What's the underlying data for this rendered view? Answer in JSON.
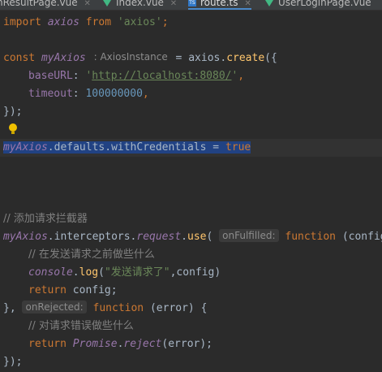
{
  "tabs": [
    {
      "label": "hResultPage.vue",
      "icon": "vue-icon",
      "active": false
    },
    {
      "label": "Index.vue",
      "icon": "vue-icon",
      "active": false
    },
    {
      "label": "route.ts",
      "icon": "ts-icon",
      "active": true
    },
    {
      "label": "UserLoginPage.vue",
      "icon": "vue-icon",
      "active": false
    }
  ],
  "editor": {
    "line1": {
      "kw_import": "import",
      "name": "axios",
      "kw_from": "from",
      "module": "'axios'",
      "semi": ";"
    },
    "line2": {
      "kw_const": "const",
      "name": "myAxios",
      "type_hint": ": AxiosInstance",
      "assign": " = axios.",
      "call": "create",
      "open": "({"
    },
    "line3": {
      "key": "baseURL",
      "colon": ": ",
      "quote_open": "'",
      "url": "http://localhost:8080/",
      "quote_close": "'",
      "comma": ","
    },
    "line4": {
      "key": "timeout",
      "colon": ": ",
      "value": "100000000",
      "comma": ","
    },
    "line5": {
      "close": "});"
    },
    "line6": {
      "obj": "myAxios",
      "rest": ".defaults.withCredentials = ",
      "value": "true"
    },
    "line7": {
      "comment": "// 添加请求拦截器"
    },
    "line8": {
      "obj": "myAxios",
      "p1": ".interceptors.",
      "p2": "request",
      "p3": ".",
      "call": "use",
      "open": "(",
      "hint": "onFulfilled:",
      "kw_function": "function",
      "args": " (config"
    },
    "line9": {
      "comment": "// 在发送请求之前做些什么"
    },
    "line10": {
      "obj": "console",
      "dot": ".",
      "call": "log",
      "open": "(",
      "str": "\"发送请求了\"",
      "rest": ",config)"
    },
    "line11": {
      "kw_return": "return",
      "rest": " config;"
    },
    "line12": {
      "close": "}, ",
      "hint": "onRejected:",
      "kw_function": "function",
      "rest": " (error) {"
    },
    "line13": {
      "comment": "// 对请求错误做些什么"
    },
    "line14": {
      "kw_return": "return",
      "obj": "Promise",
      "dot": ".",
      "call": "reject",
      "rest": "(error);"
    },
    "line15": {
      "close": "});"
    }
  },
  "colors": {
    "background": "#2b2b2b",
    "keyword": "#cc7832",
    "string": "#6a8759",
    "number": "#6897bb",
    "comment": "#808080",
    "selection": "#214283"
  }
}
